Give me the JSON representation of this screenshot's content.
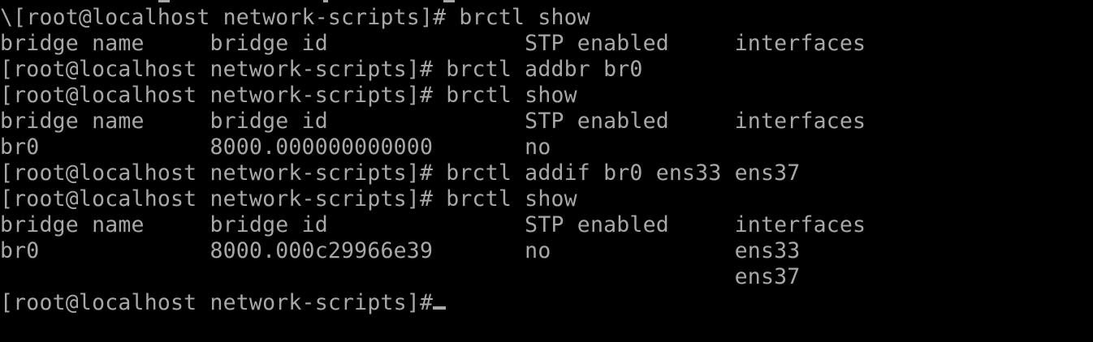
{
  "terminal": {
    "colors": {
      "background": "#000000",
      "foreground": "#a8a8a8"
    },
    "lines": [
      "\\[root@localhost network-scripts]# brctl show",
      "bridge name     bridge id               STP enabled     interfaces",
      "[root@localhost network-scripts]# brctl addbr br0",
      "[root@localhost network-scripts]# brctl show",
      "bridge name     bridge id               STP enabled     interfaces",
      "br0             8000.000000000000       no",
      "[root@localhost network-scripts]# brctl addif br0 ens33 ens37",
      "[root@localhost network-scripts]# brctl show",
      "bridge name     bridge id               STP enabled     interfaces",
      "br0             8000.000c29966e39       no              ens33",
      "                                                        ens37",
      "[root@localhost network-scripts]#"
    ]
  }
}
